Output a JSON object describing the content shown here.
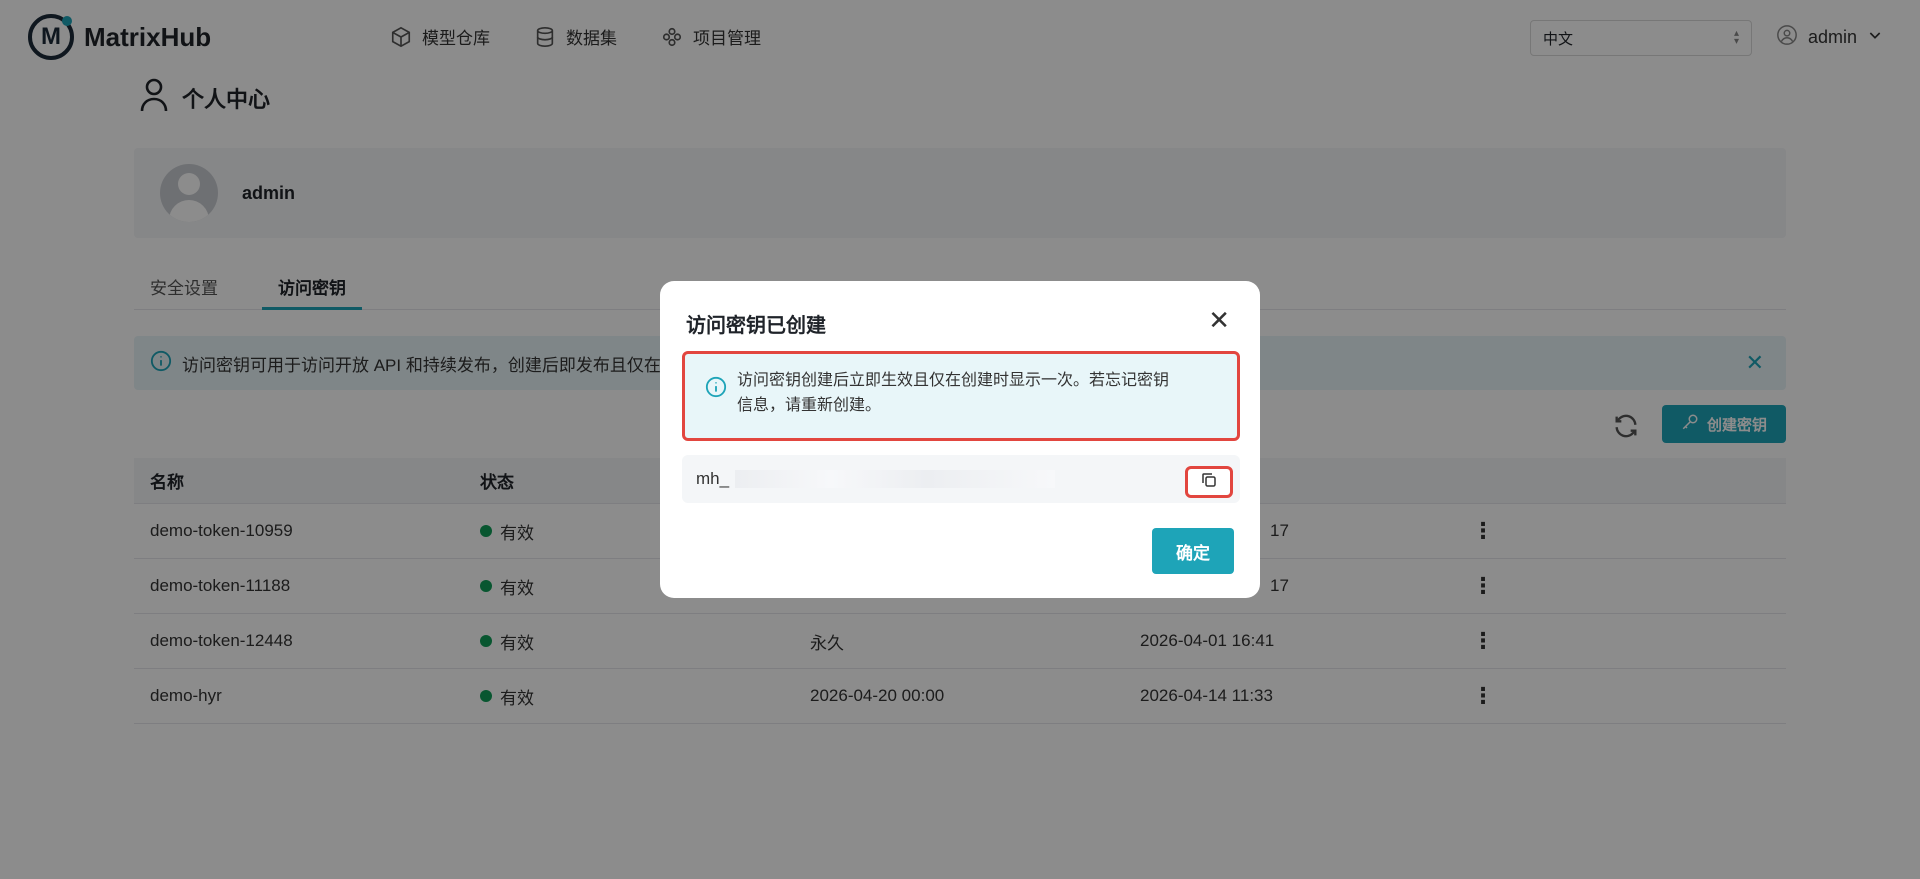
{
  "header": {
    "app_name": "MatrixHub",
    "nav": [
      {
        "label": "模型仓库",
        "icon": "cube-icon"
      },
      {
        "label": "数据集",
        "icon": "database-icon"
      },
      {
        "label": "项目管理",
        "icon": "project-icon"
      }
    ],
    "language": "中文",
    "user": "admin"
  },
  "page": {
    "title": "个人中心",
    "profile_name": "admin",
    "tabs": [
      "安全设置",
      "访问密钥"
    ],
    "active_tab": "访问密钥",
    "alert_text": "访问密钥可用于访问开放 API 和持续发布，创建后即发布且仅在",
    "create_button": "创建密钥",
    "table": {
      "headers": [
        "名称",
        "状态"
      ],
      "rows": [
        {
          "name": "demo-token-10959",
          "status": "有效",
          "expire": "",
          "created": "17"
        },
        {
          "name": "demo-token-11188",
          "status": "有效",
          "expire": "",
          "created": "17"
        },
        {
          "name": "demo-token-12448",
          "status": "有效",
          "expire": "永久",
          "created": "2026-04-01 16:41"
        },
        {
          "name": "demo-hyr",
          "status": "有效",
          "expire": "2026-04-20 00:00",
          "created": "2026-04-14 11:33"
        }
      ]
    }
  },
  "modal": {
    "title": "访问密钥已创建",
    "alert_line1": "访问密钥创建后立即生效且仅在创建时显示一次。若忘记密钥",
    "alert_line2": "信息，请重新创建。",
    "key_prefix": "mh_",
    "ok_button": "确定"
  },
  "colors": {
    "accent": "#1ea4b8",
    "highlight": "#e2463f",
    "status_ok": "#0f9d58"
  }
}
